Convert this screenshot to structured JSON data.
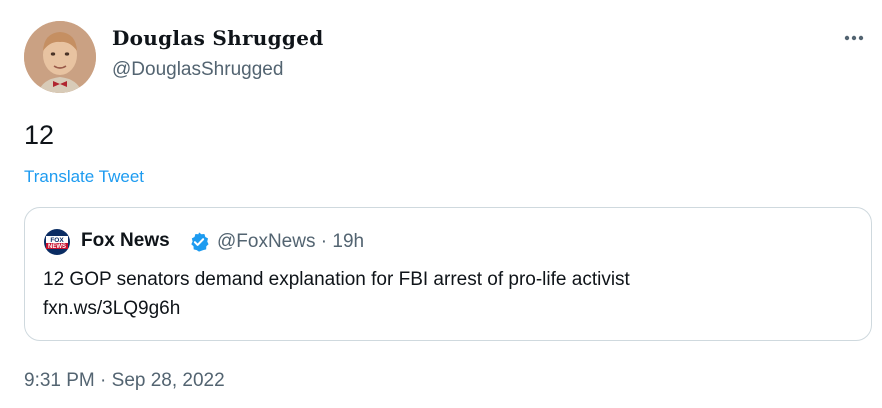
{
  "author": {
    "display_name": "Douglas Shrugged",
    "handle": "@DouglasShrugged"
  },
  "tweet": {
    "text": "12",
    "translate_label": "Translate Tweet",
    "timestamp": "9:31 PM · Sep 28, 2022"
  },
  "quoted_tweet": {
    "logo_lines": [
      "FOX",
      "NEWS"
    ],
    "display_name": "Fox News",
    "handle": "@FoxNews",
    "separator": "·",
    "age": "19h",
    "text_line1": "12 GOP senators demand explanation for FBI arrest of pro-life activist",
    "text_line2": "fxn.ws/3LQ9g6h"
  },
  "icons": {
    "more": "more-horizontal-icon",
    "verified": "verified-badge-icon"
  },
  "colors": {
    "link": "#1d9bf0",
    "secondary_text": "#536471",
    "border": "#cfd9de",
    "verified": "#1d9bf0"
  }
}
